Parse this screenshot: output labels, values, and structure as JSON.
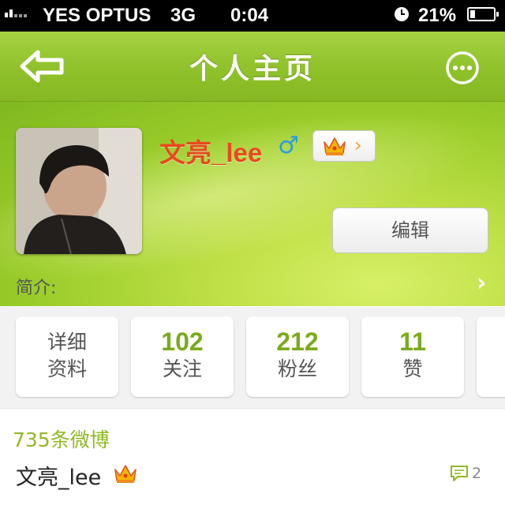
{
  "status_bar": {
    "carrier": "YES OPTUS",
    "network": "3G",
    "time": "0:04",
    "battery": "21%",
    "battery_level": 0.21
  },
  "nav": {
    "title": "个人主页",
    "back_icon": "back-arrow-icon",
    "more_icon": "more-icon"
  },
  "profile": {
    "username": "文亮_lee",
    "gender_symbol": "♂",
    "edit_label": "编辑",
    "intro_label": "简介:",
    "vip_icon": "crown-icon"
  },
  "stats": [
    {
      "line1": "详细",
      "line2": "资料"
    },
    {
      "value": "102",
      "label": "关注"
    },
    {
      "value": "212",
      "label": "粉丝"
    },
    {
      "value": "11",
      "label": "赞"
    }
  ],
  "feed": {
    "count_label": "735条微博",
    "post_author": "文亮_lee",
    "comment_count": "2"
  },
  "colors": {
    "accent_green": "#8fc12a",
    "username_orange": "#e8491d",
    "stat_green": "#7aab1c"
  }
}
